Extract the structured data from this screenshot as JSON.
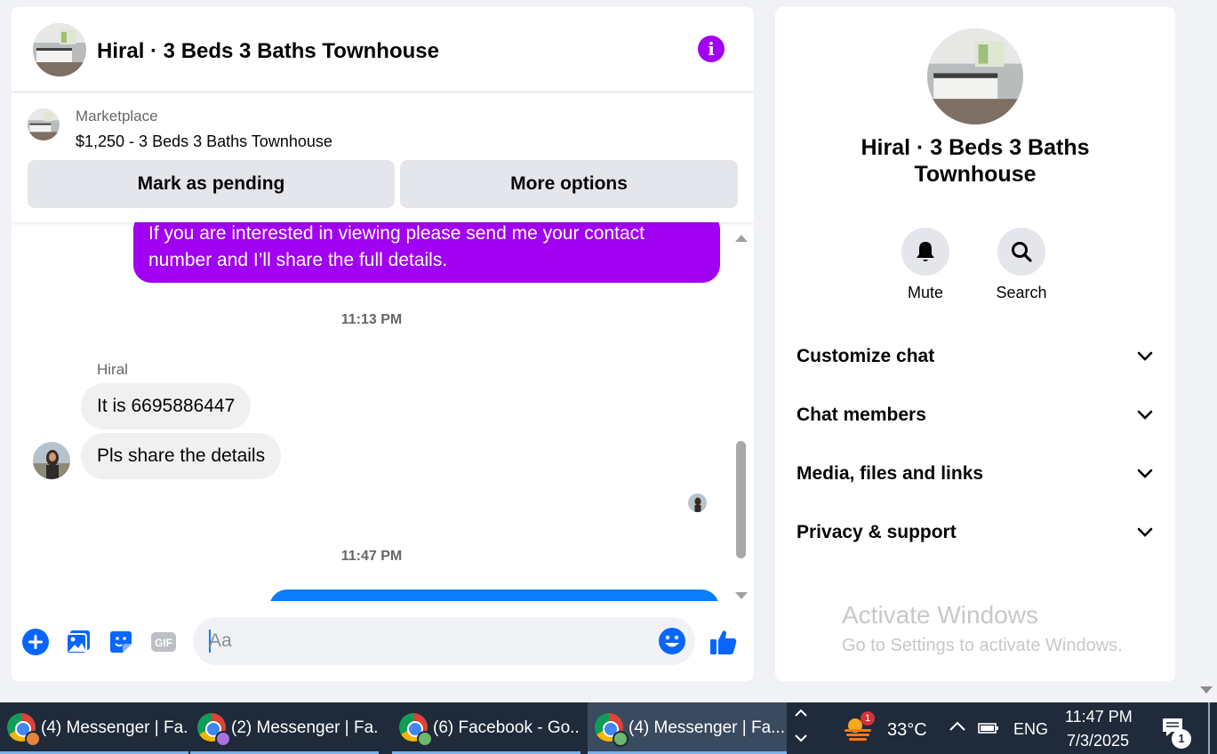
{
  "chat": {
    "title": "Hiral · 3 Beds 3 Baths Townhouse",
    "info_icon": "info-icon",
    "marketplace": {
      "label": "Marketplace",
      "listing": "$1,250 - 3 Beds 3 Baths Townhouse",
      "mark_pending_label": "Mark as pending",
      "more_options_label": "More options"
    },
    "messages": {
      "outgoing_1": "If you are interested in viewing please send me your contact number and I’ll share the full details.",
      "time_1": "11:13 PM",
      "sender_name": "Hiral",
      "incoming_1": "It is 6695886447",
      "incoming_2": "Pls share the details",
      "time_2": "11:47 PM"
    },
    "composer": {
      "placeholder": "Aa",
      "value": "",
      "icons": [
        "plus-icon",
        "image-icon",
        "sticker-icon",
        "gif-icon",
        "emoji-icon",
        "like-icon"
      ],
      "gif_text": "GIF"
    },
    "colors": {
      "accent_purple": "#a100f2",
      "outgoing_blue": "#0a7cff",
      "messenger_blue": "#0866ff"
    }
  },
  "info": {
    "title": "Hiral · 3 Beds 3 Baths Townhouse",
    "actions": [
      {
        "label": "Mute",
        "icon": "bell-icon"
      },
      {
        "label": "Search",
        "icon": "search-icon"
      }
    ],
    "sections": [
      {
        "label": "Customize chat"
      },
      {
        "label": "Chat members"
      },
      {
        "label": "Media, files and links"
      },
      {
        "label": "Privacy & support"
      }
    ],
    "watermark": {
      "title": "Activate Windows",
      "subtitle": "Go to Settings to activate Windows."
    }
  },
  "taskbar": {
    "tasks": [
      {
        "label": "(4) Messenger | Fa...",
        "profile_color": "#e8833a"
      },
      {
        "label": "(2) Messenger | Fa...",
        "profile_color": "#a970e0"
      },
      {
        "label": "(6) Facebook - Go...",
        "profile_color": "#6cb86c"
      },
      {
        "label": "(4) Messenger | Fa...",
        "profile_color": "#6cb86c"
      }
    ],
    "weather_badge": "1",
    "temperature": "33°C",
    "language": "ENG",
    "time": "11:47 PM",
    "date": "7/3/2025",
    "notification_count": "1"
  }
}
